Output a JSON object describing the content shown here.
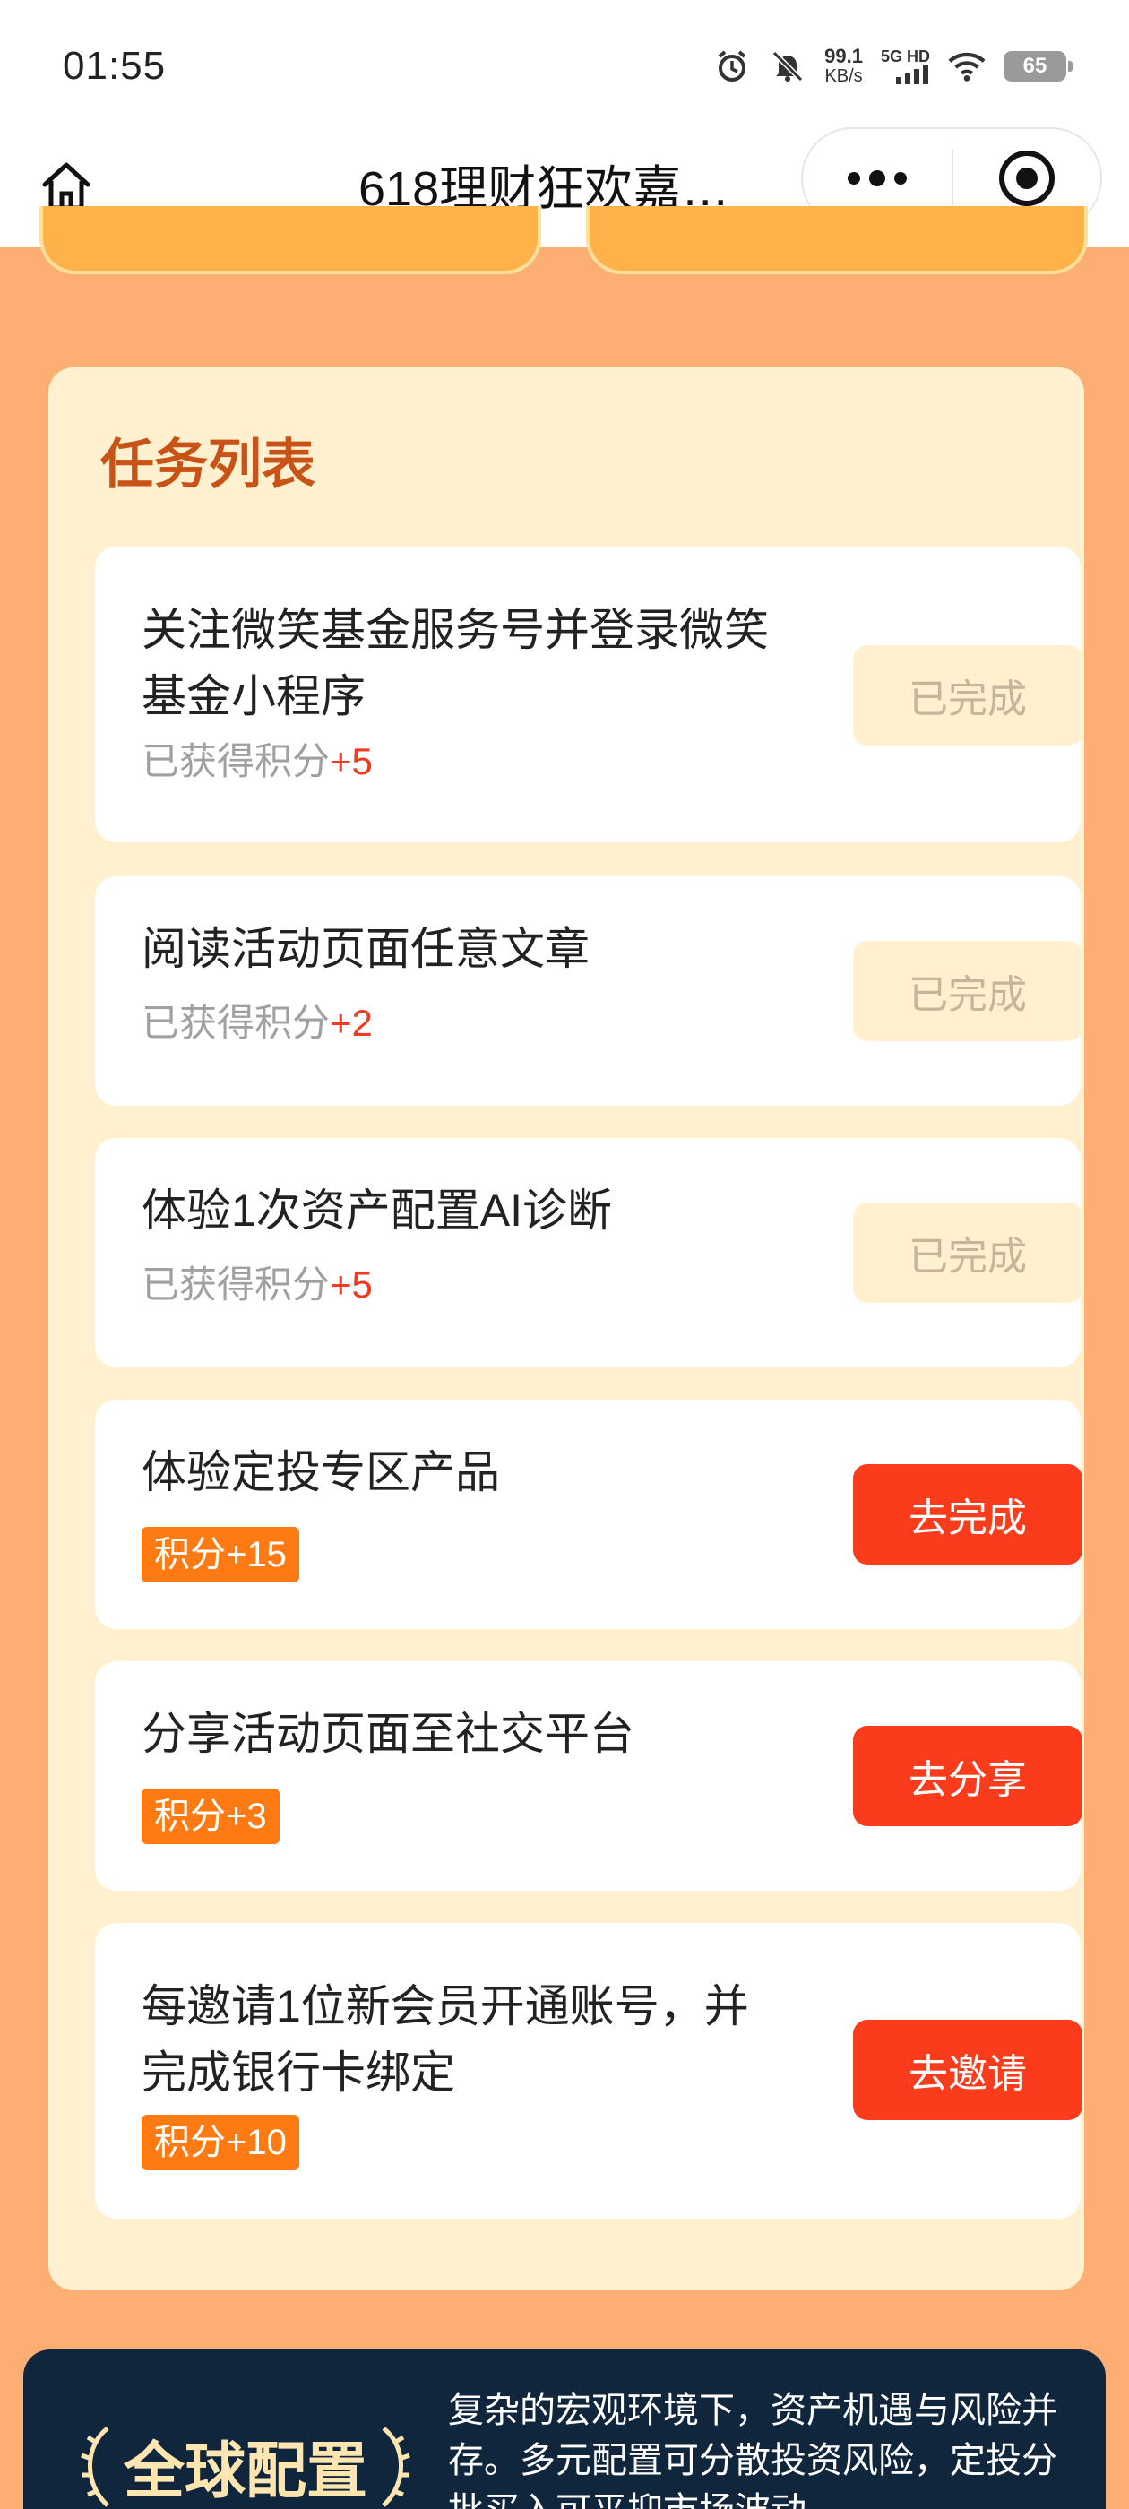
{
  "status_bar": {
    "time": "01:55",
    "net_speed_value": "99.1",
    "net_speed_unit": "KB/s",
    "signal_label": "5G HD",
    "battery": "65",
    "icons": [
      "alarm-icon",
      "mute-icon",
      "signal-icon",
      "wifi-icon",
      "battery-icon"
    ]
  },
  "nav": {
    "title": "618理财狂欢嘉…",
    "icons": [
      "home-icon",
      "more-icon",
      "close-icon"
    ]
  },
  "panel": {
    "title": "任务列表"
  },
  "tasks": [
    {
      "title": "关注微笑基金服务号并登录微笑基金小程序",
      "sub_prefix": "已获得积分",
      "sub_points": "+5",
      "button": "已完成",
      "status": "done"
    },
    {
      "title": "阅读活动页面任意文章",
      "sub_prefix": "已获得积分",
      "sub_points": "+2",
      "button": "已完成",
      "status": "done"
    },
    {
      "title": "体验1次资产配置AI诊断",
      "sub_prefix": "已获得积分",
      "sub_points": "+5",
      "button": "已完成",
      "status": "done"
    },
    {
      "title": "体验定投专区产品",
      "badge": "积分+15",
      "button": "去完成",
      "status": "todo"
    },
    {
      "title": "分享活动页面至社交平台",
      "badge": "积分+3",
      "button": "去分享",
      "status": "todo"
    },
    {
      "title": "每邀请1位新会员开通账号，并完成银行卡绑定",
      "badge": "积分+10",
      "button": "去邀请",
      "status": "todo"
    }
  ],
  "banner": {
    "title": "全球配置",
    "description": "复杂的宏观环境下，资产机遇与风险并存。多元配置可分散投资风险，定投分批买入可平抑市场波动"
  },
  "colors": {
    "page_bg": "#fdae72",
    "panel_bg": "#fff0d0",
    "title_accent": "#c95216",
    "points_red": "#f03a22",
    "badge_orange": "#ff7a12",
    "button_red": "#fa3b1c",
    "button_done_bg": "#fff0cf",
    "banner_bg": "#10263d"
  }
}
